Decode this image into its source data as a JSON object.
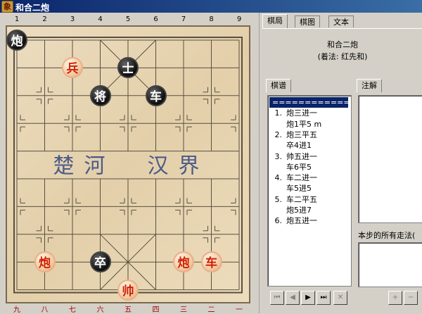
{
  "window": {
    "title": "和合二炮",
    "app_icon_glyph": "象"
  },
  "board": {
    "file_labels_top": [
      "1",
      "2",
      "3",
      "4",
      "5",
      "6",
      "7",
      "8",
      "9"
    ],
    "file_labels_bottom": [
      "九",
      "八",
      "七",
      "六",
      "五",
      "四",
      "三",
      "二",
      "一"
    ],
    "river_left": "楚河",
    "river_right": "汉界",
    "pieces": [
      {
        "name": "black-cannon",
        "side": "black",
        "glyph": "炮",
        "file": 0,
        "rank": 0
      },
      {
        "name": "black-advisor",
        "side": "black",
        "glyph": "士",
        "file": 4,
        "rank": 1
      },
      {
        "name": "black-general",
        "side": "black",
        "glyph": "将",
        "file": 3,
        "rank": 2
      },
      {
        "name": "black-chariot",
        "side": "black",
        "glyph": "车",
        "file": 5,
        "rank": 2
      },
      {
        "name": "black-soldier",
        "side": "black",
        "glyph": "卒",
        "file": 3,
        "rank": 8
      },
      {
        "name": "red-soldier",
        "side": "red",
        "glyph": "兵",
        "file": 2,
        "rank": 1
      },
      {
        "name": "red-cannon-left",
        "side": "red",
        "glyph": "炮",
        "file": 1,
        "rank": 8
      },
      {
        "name": "red-cannon-right",
        "side": "red",
        "glyph": "炮",
        "file": 6,
        "rank": 8
      },
      {
        "name": "red-chariot",
        "side": "red",
        "glyph": "车",
        "file": 7,
        "rank": 8
      },
      {
        "name": "red-king",
        "side": "red",
        "glyph": "帅",
        "file": 4,
        "rank": 9
      }
    ]
  },
  "tabs": {
    "top": [
      "棋局",
      "棋图",
      "文本"
    ],
    "left": "棋谱",
    "right": "注解"
  },
  "info": {
    "title": "和合二炮",
    "subtitle": "(着法: 红先和)"
  },
  "moves": [
    {
      "num": "",
      "text": "============",
      "selected": true
    },
    {
      "num": "1.",
      "text": "炮三进一",
      "selected": false
    },
    {
      "num": "",
      "text": "炮1平5  m",
      "selected": false
    },
    {
      "num": "2.",
      "text": "炮三平五",
      "selected": false
    },
    {
      "num": "",
      "text": "卒4进1",
      "selected": false
    },
    {
      "num": "3.",
      "text": "帅五进一",
      "selected": false
    },
    {
      "num": "",
      "text": "车6平5",
      "selected": false
    },
    {
      "num": "4.",
      "text": "车二进一",
      "selected": false
    },
    {
      "num": "",
      "text": "车5进5",
      "selected": false
    },
    {
      "num": "5.",
      "text": "车二平五",
      "selected": false
    },
    {
      "num": "",
      "text": "炮5进7",
      "selected": false
    },
    {
      "num": "6.",
      "text": "炮五进一",
      "selected": false
    }
  ],
  "all_moves_label": "本步的所有走法(",
  "nav": {
    "first": "⏮",
    "prev": "◀",
    "next": "▶",
    "last": "⏭",
    "delete": "✕",
    "add": "+",
    "remove": "−"
  },
  "colors": {
    "red_piece_text": "#d02000",
    "black_piece_bg": "#111111",
    "board_bg": "#e3cfa9",
    "selection": "#0a246a"
  }
}
